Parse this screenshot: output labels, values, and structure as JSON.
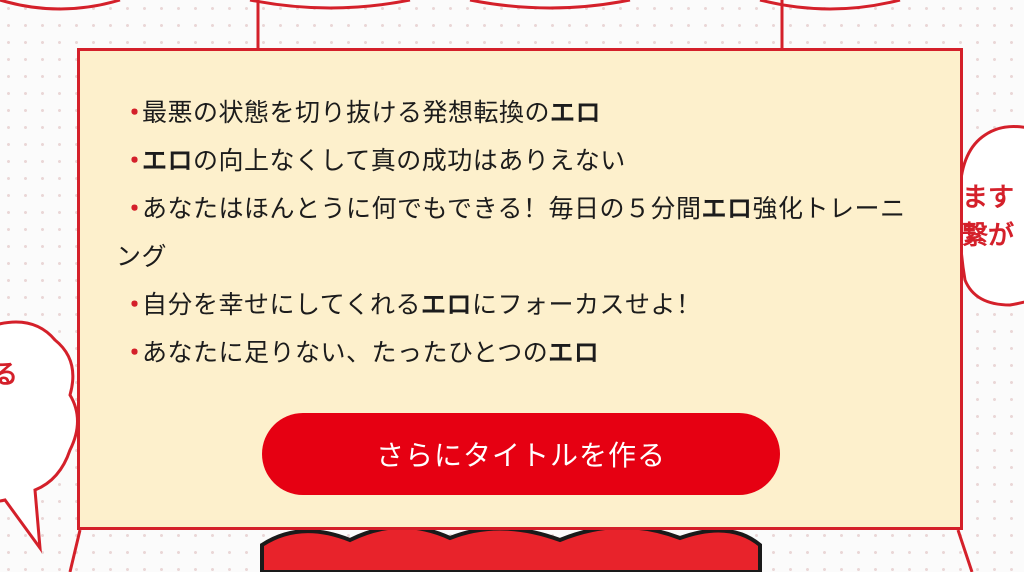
{
  "background": {
    "speech_left_text": "る",
    "speech_right_lines": [
      "ます",
      "繋が"
    ]
  },
  "panel": {
    "items": [
      {
        "parts": [
          {
            "text": "最悪の状態を切り抜ける発想転換の",
            "bold": false
          },
          {
            "text": "エロ",
            "bold": true
          }
        ]
      },
      {
        "parts": [
          {
            "text": "エロ",
            "bold": true
          },
          {
            "text": "の向上なくして真の成功はありえない",
            "bold": false
          }
        ]
      },
      {
        "parts": [
          {
            "text": "あなたはほんとうに何でもできる！毎日の５分間",
            "bold": false
          },
          {
            "text": "エロ",
            "bold": true
          },
          {
            "text": "強化トレーニング",
            "bold": false
          }
        ]
      },
      {
        "parts": [
          {
            "text": "自分を幸せにしてくれる",
            "bold": false
          },
          {
            "text": "エロ",
            "bold": true
          },
          {
            "text": "にフォーカスせよ！",
            "bold": false
          }
        ]
      },
      {
        "parts": [
          {
            "text": "あなたに足りない、たったひとつの",
            "bold": false
          },
          {
            "text": "エロ",
            "bold": true
          }
        ]
      }
    ],
    "bullet_glyph": "・",
    "cta_label": "さらにタイトルを作る"
  },
  "colors": {
    "accent": "#d4202a",
    "button": "#e60012",
    "panel_bg": "#fdf0cc"
  }
}
